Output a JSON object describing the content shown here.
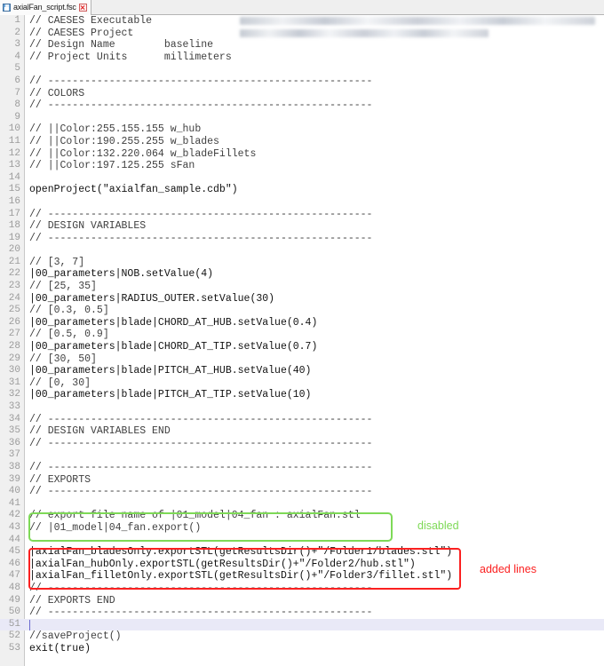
{
  "window": {
    "tab": {
      "title": "axialFan_script.fsc",
      "save_icon": "floppy-disk-icon",
      "close_icon": "close-icon"
    }
  },
  "editor": {
    "current_line": 51,
    "total_visible_lines": 53,
    "redacted_lines": [
      1,
      2
    ],
    "lines": [
      {
        "n": 1,
        "text": "// CAESES Executable",
        "comment": true
      },
      {
        "n": 2,
        "text": "// CAESES Project",
        "comment": true
      },
      {
        "n": 3,
        "text": "// Design Name        baseline",
        "comment": true
      },
      {
        "n": 4,
        "text": "// Project Units      millimeters",
        "comment": true
      },
      {
        "n": 5,
        "text": "",
        "comment": false
      },
      {
        "n": 6,
        "text": "// -----------------------------------------------------",
        "comment": true
      },
      {
        "n": 7,
        "text": "// COLORS",
        "comment": true
      },
      {
        "n": 8,
        "text": "// -----------------------------------------------------",
        "comment": true
      },
      {
        "n": 9,
        "text": "",
        "comment": false
      },
      {
        "n": 10,
        "text": "// ||Color:255.155.155 w_hub",
        "comment": true
      },
      {
        "n": 11,
        "text": "// ||Color:190.255.255 w_blades",
        "comment": true
      },
      {
        "n": 12,
        "text": "// ||Color:132.220.064 w_bladeFillets",
        "comment": true
      },
      {
        "n": 13,
        "text": "// ||Color:197.125.255 sFan",
        "comment": true
      },
      {
        "n": 14,
        "text": "",
        "comment": false
      },
      {
        "n": 15,
        "text": "openProject(\"axialfan_sample.cdb\")",
        "comment": false
      },
      {
        "n": 16,
        "text": "",
        "comment": false
      },
      {
        "n": 17,
        "text": "// -----------------------------------------------------",
        "comment": true
      },
      {
        "n": 18,
        "text": "// DESIGN VARIABLES",
        "comment": true
      },
      {
        "n": 19,
        "text": "// -----------------------------------------------------",
        "comment": true
      },
      {
        "n": 20,
        "text": "",
        "comment": false
      },
      {
        "n": 21,
        "text": "// [3, 7]",
        "comment": true
      },
      {
        "n": 22,
        "text": "|00_parameters|NOB.setValue(4)",
        "comment": false
      },
      {
        "n": 23,
        "text": "// [25, 35]",
        "comment": true
      },
      {
        "n": 24,
        "text": "|00_parameters|RADIUS_OUTER.setValue(30)",
        "comment": false
      },
      {
        "n": 25,
        "text": "// [0.3, 0.5]",
        "comment": true
      },
      {
        "n": 26,
        "text": "|00_parameters|blade|CHORD_AT_HUB.setValue(0.4)",
        "comment": false
      },
      {
        "n": 27,
        "text": "// [0.5, 0.9]",
        "comment": true
      },
      {
        "n": 28,
        "text": "|00_parameters|blade|CHORD_AT_TIP.setValue(0.7)",
        "comment": false
      },
      {
        "n": 29,
        "text": "// [30, 50]",
        "comment": true
      },
      {
        "n": 30,
        "text": "|00_parameters|blade|PITCH_AT_HUB.setValue(40)",
        "comment": false
      },
      {
        "n": 31,
        "text": "// [0, 30]",
        "comment": true
      },
      {
        "n": 32,
        "text": "|00_parameters|blade|PITCH_AT_TIP.setValue(10)",
        "comment": false
      },
      {
        "n": 33,
        "text": "",
        "comment": false
      },
      {
        "n": 34,
        "text": "// -----------------------------------------------------",
        "comment": true
      },
      {
        "n": 35,
        "text": "// DESIGN VARIABLES END",
        "comment": true
      },
      {
        "n": 36,
        "text": "// -----------------------------------------------------",
        "comment": true
      },
      {
        "n": 37,
        "text": "",
        "comment": false
      },
      {
        "n": 38,
        "text": "// -----------------------------------------------------",
        "comment": true
      },
      {
        "n": 39,
        "text": "// EXPORTS",
        "comment": true
      },
      {
        "n": 40,
        "text": "// -----------------------------------------------------",
        "comment": true
      },
      {
        "n": 41,
        "text": "",
        "comment": false
      },
      {
        "n": 42,
        "text": "// export file name of |01_model|04_fan : axialFan.stl",
        "comment": true
      },
      {
        "n": 43,
        "text": "// |01_model|04_fan.export()",
        "comment": true
      },
      {
        "n": 44,
        "text": "",
        "comment": false
      },
      {
        "n": 45,
        "text": "|axialFan_bladesOnly.exportSTL(getResultsDir()+\"/Folder1/blades.stl\")",
        "comment": false
      },
      {
        "n": 46,
        "text": "|axialFan_hubOnly.exportSTL(getResultsDir()+\"/Folder2/hub.stl\")",
        "comment": false
      },
      {
        "n": 47,
        "text": "|axialFan_filletOnly.exportSTL(getResultsDir()+\"/Folder3/fillet.stl\")",
        "comment": false
      },
      {
        "n": 48,
        "text": "// -----------------------------------------------------",
        "comment": true
      },
      {
        "n": 49,
        "text": "// EXPORTS END",
        "comment": true
      },
      {
        "n": 50,
        "text": "// -----------------------------------------------------",
        "comment": true
      },
      {
        "n": 51,
        "text": "",
        "comment": false
      },
      {
        "n": 52,
        "text": "//saveProject()",
        "comment": true
      },
      {
        "n": 53,
        "text": "exit(true)",
        "comment": false
      }
    ]
  },
  "annotations": [
    {
      "id": "disabled",
      "label": "disabled",
      "color": "#7ed957",
      "shape": "rounded-rectangle",
      "covers_lines": [
        42,
        43
      ]
    },
    {
      "id": "added-lines",
      "label": "added lines",
      "color": "#fb2020",
      "shape": "rounded-rectangle",
      "covers_lines": [
        45,
        46,
        47
      ]
    }
  ]
}
